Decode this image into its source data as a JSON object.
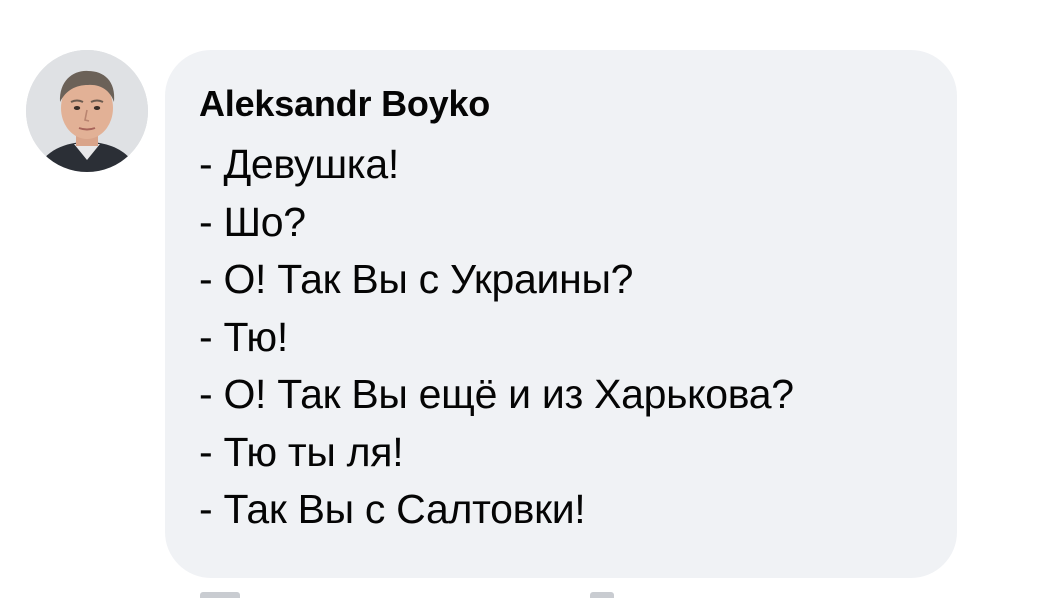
{
  "comment": {
    "author": "Aleksandr Boyko",
    "avatar_icon": "user-photo-avatar",
    "lines": [
      "- Девушка!",
      "- Шо?",
      "- О! Так Вы с Украины?",
      "- Тю!",
      "- О! Так Вы ещё и из Харькова?",
      "- Тю ты ля!",
      "- Так Вы с Салтовки!"
    ],
    "bubble_color": "#f0f2f5",
    "text_color": "#050505"
  }
}
